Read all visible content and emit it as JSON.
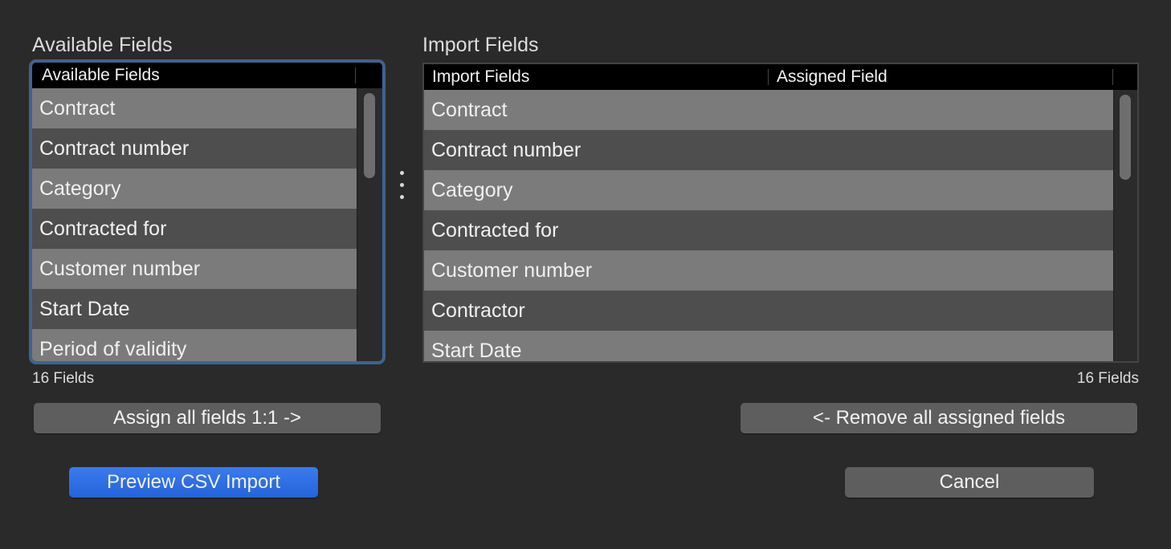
{
  "available": {
    "title": "Available Fields",
    "header": "Available Fields",
    "items": [
      "Contract",
      "Contract number",
      "Category",
      "Contracted for",
      "Customer number",
      "Start Date",
      "Period of validity"
    ],
    "count_label": "16 Fields"
  },
  "import": {
    "title": "Import Fields",
    "header_fields": "Import Fields",
    "header_assigned": "Assigned Field",
    "items": [
      "Contract",
      "Contract number",
      "Category",
      "Contracted for",
      "Customer number",
      "Contractor",
      "Start Date"
    ],
    "count_label": "16 Fields"
  },
  "buttons": {
    "assign_all": "Assign all fields 1:1 ->",
    "remove_all": "<- Remove all assigned fields",
    "preview": "Preview CSV Import",
    "cancel": "Cancel"
  },
  "icons": {
    "handle": "vertical-ellipsis-icon"
  },
  "colors": {
    "accent": "#2d6ee3",
    "focus_ring": "#3e6390"
  }
}
